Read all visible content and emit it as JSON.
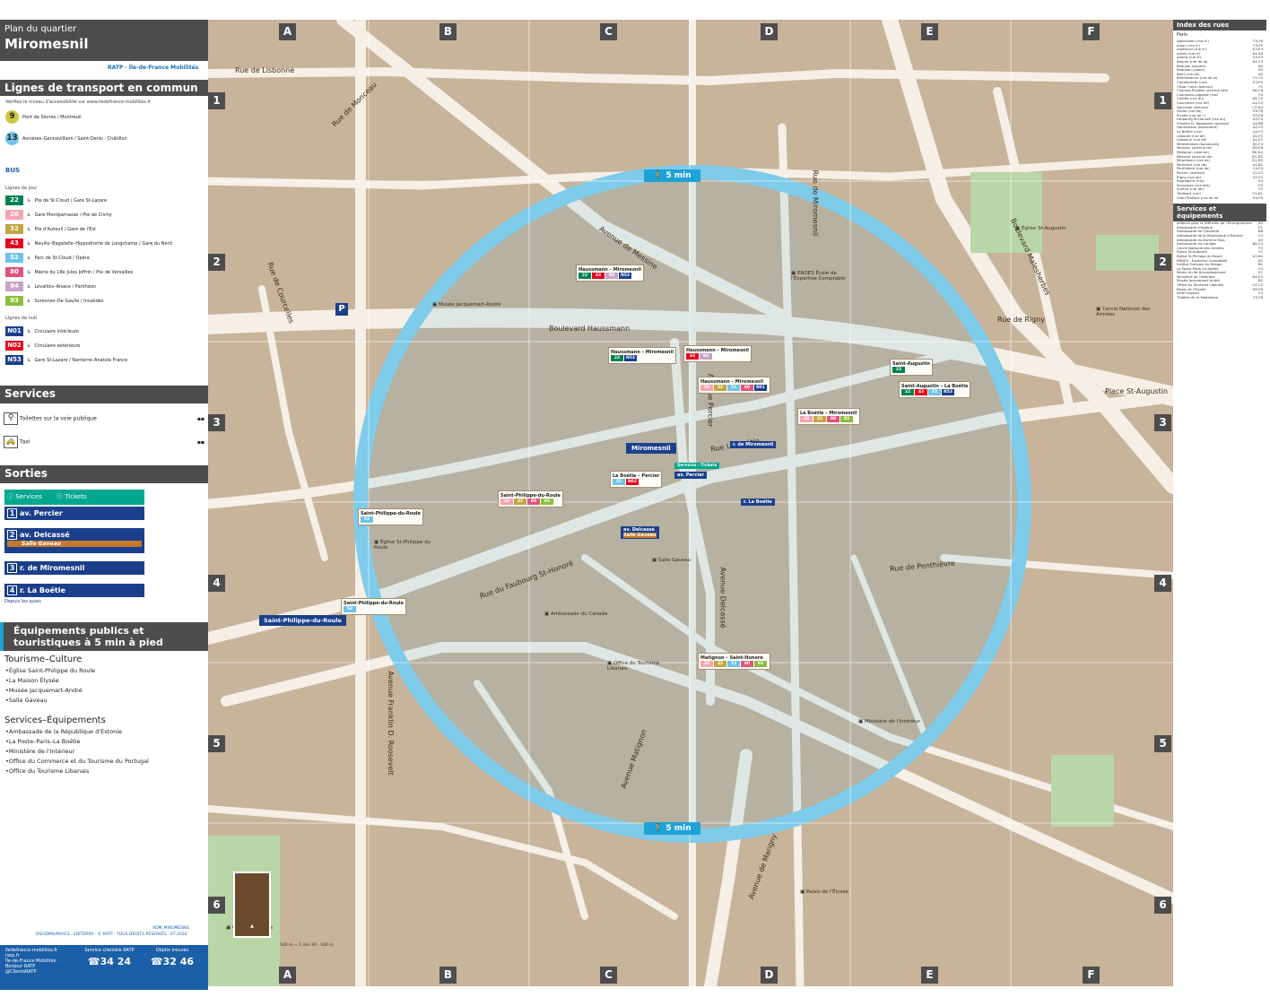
{
  "header": {
    "subtitle": "Plan du quartier",
    "title": "Miromesnil",
    "partners": "RATP · Île-de-France Mobilités"
  },
  "transport": {
    "heading": "Lignes de transport en commun",
    "note": "Vérifiez le niveau d'accessibilité sur www.iledefrance-mobilites.fr",
    "metro": [
      {
        "line": "9",
        "color": "#cdc83f",
        "dest": "Pont de Sèvres / Montreuil"
      },
      {
        "line": "13",
        "color": "#6ec4e8",
        "dest": "Asnières–Gennevilliers / Saint-Denis · Châtillon"
      }
    ],
    "bus_label": "BUS",
    "day_label": "Lignes de jour",
    "bus": [
      {
        "line": "22",
        "color": "#00814f",
        "dest": "Pte de St-Cloud / Gare St-Lazare"
      },
      {
        "line": "28",
        "color": "#f7a3b1",
        "dest": "Gare Montparnasse / Pte de Clichy"
      },
      {
        "line": "32",
        "color": "#c2a642",
        "dest": "Pte d'Auteuil / Gare de l'Est"
      },
      {
        "line": "43",
        "color": "#e3051b",
        "dest": "Neuilly–Bagatelle–Hippodrome de Longchamp / Gare du Nord"
      },
      {
        "line": "52",
        "color": "#6ec4e8",
        "dest": "Parc de St-Cloud / Opéra"
      },
      {
        "line": "80",
        "color": "#e0547a",
        "dest": "Mairie du 18e Jules Joffrin / Pte de Versailles"
      },
      {
        "line": "84",
        "color": "#c9a2c9",
        "dest": "Levallois–Alsace / Panthéon"
      },
      {
        "line": "93",
        "color": "#8cbe3f",
        "dest": "Suresnes–De Gaulle / Invalides"
      }
    ],
    "night_label": "Lignes de nuit",
    "night": [
      {
        "line": "N01",
        "color": "#1b3f8b",
        "dest": "Circulaire intérieure"
      },
      {
        "line": "N02",
        "color": "#e3051b",
        "dest": "Circulaire extérieure"
      },
      {
        "line": "N53",
        "color": "#1b3f8b",
        "dest": "Gare St-Lazare / Nanterre–Anatole France"
      }
    ]
  },
  "services": {
    "heading": "Services",
    "items": [
      "Toilettes sur la voie publique",
      "Taxi"
    ]
  },
  "sorties": {
    "heading": "Sorties",
    "services_label": "Services",
    "tickets_label": "Tickets",
    "exits": [
      {
        "n": "1",
        "name": "av. Percier"
      },
      {
        "n": "2",
        "name": "av. Delcassé",
        "sub": "Salle Gaveau"
      },
      {
        "n": "3",
        "name": "r. de Miromesnil"
      },
      {
        "n": "4",
        "name": "r. La Boétie",
        "sub": "Depuis les quais"
      }
    ]
  },
  "equipements": {
    "heading": "Équipements publics et touristiques à 5 min à pied",
    "tourism_h": "Tourisme–Culture",
    "tourism": [
      "•Église Saint-Philippe du Roule",
      "•La Maison Élysée",
      "•Musée Jacquemart-André",
      "•Salle Gaveau"
    ],
    "serv_h": "Services–Équipements",
    "serv": [
      "•Ambassade de la République d'Estonie",
      "•La Poste–Paris–La Boétie",
      "•Ministère de l'Intérieur",
      "•Office du Commerce et du Tourisme du Portugal",
      "•Office du Tourisme Libanais"
    ]
  },
  "footer": {
    "web": "iledefrance-mobilites.fr",
    "app": "ratp.fr",
    "bonjour": "Île-de-France Mobilités · Bonjour RATP",
    "twitter": "@ClientsRATP",
    "client_label": "Service clientèle RATP",
    "client_num": "34 24",
    "lost_label": "Objets trouvés",
    "lost_num": "32 46",
    "credit": "DSF/DMO/RIVICS · EDITERRA · © RATP · TOUS DROITS RÉSERVÉS · 07.2024",
    "ref": "ADM_MIROMESNIL",
    "scale_100": "100 m",
    "scale_time": "100 m = 1 min 30"
  },
  "map": {
    "walk_label": "5 min",
    "cols": [
      "A",
      "B",
      "C",
      "D",
      "E",
      "F"
    ],
    "rows": [
      "1",
      "2",
      "3",
      "4",
      "5",
      "6"
    ],
    "streets": [
      "Rue de Lisbonne",
      "Avenue de Messine",
      "Boulevard Haussmann",
      "Rue La Boétie",
      "Rue du Faubourg St-Honoré",
      "Avenue Percier",
      "Avenue Delcassé",
      "Rue de Miromesnil",
      "Boulevard Malesherbes",
      "Avenue Franklin D. Roosevelt",
      "Avenue de Marigny",
      "Place St-Augustin",
      "Rue de Penthièvre",
      "Rue de Courcelles",
      "Avenue Matignon",
      "Rue de Monceau",
      "Rue de Rigny"
    ],
    "places": [
      "Musée Jacquemart-André",
      "Église St-Augustin",
      "Ministère de l'Intérieur",
      "Église St-Philippe du Roule",
      "Salle Gaveau",
      "Cercle National des Armées",
      "Palais de l'Élysée",
      "Ambassade du Canada",
      "Office du Tourisme Libanais",
      "ENDES École de l'Expertise Comptable",
      "Champs-Élysées"
    ],
    "stops": [
      {
        "name": "Haussmann – Miromesnil",
        "lines": [
          "22",
          "43",
          "84",
          "N53"
        ]
      },
      {
        "name": "Haussmann – Miromesnil",
        "lines": [
          "22",
          "N53"
        ]
      },
      {
        "name": "Haussmann – Miromesnil",
        "lines": [
          "43",
          "84"
        ]
      },
      {
        "name": "Haussmann – Miromesnil",
        "lines": [
          "28",
          "32",
          "52",
          "80",
          "N01"
        ]
      },
      {
        "name": "La Boétie – Miromesnil",
        "lines": [
          "28",
          "32",
          "80",
          "93"
        ]
      },
      {
        "name": "Saint-Augustin",
        "lines": [
          "22"
        ]
      },
      {
        "name": "Saint-Augustin – La Boétie",
        "lines": [
          "22",
          "43",
          "52",
          "N53"
        ]
      },
      {
        "name": "La Boétie – Percier",
        "lines": [
          "52",
          "N02"
        ]
      },
      {
        "name": "Saint-Philippe-du-Roule",
        "lines": [
          "28",
          "32",
          "80",
          "93"
        ]
      },
      {
        "name": "Saint-Philippe-du-Roule",
        "lines": [
          "52"
        ]
      },
      {
        "name": "Saint-Philippe-du-Roule",
        "lines": [
          "52"
        ]
      },
      {
        "name": "Matignon – Saint-Honoré",
        "lines": [
          "28",
          "32",
          "52",
          "80",
          "93"
        ]
      }
    ],
    "metro_station": "Miromesnil",
    "metro_station2": "Saint-Philippe-du-Roule",
    "exit_labels": [
      "av. Percier",
      "r. de Miromesnil",
      "r. La Boétie",
      "av. Delcassé"
    ],
    "exit_sub": "Salle Gaveau",
    "services_tickets": "Services · Tickets"
  },
  "index": {
    "heading": "Index des rues",
    "city": "Paris",
    "streets": [
      [
        "Aguesseau (rue d')",
        "F5-F6"
      ],
      [
        "Anjou (rue d')",
        "F3-F5"
      ],
      [
        "Argenson (rue d')",
        "E3-E4"
      ],
      [
        "Artois (rue d')",
        "A4-A5"
      ],
      [
        "Astorg (rue d')",
        "E3-F3"
      ],
      [
        "Baume (rue de la)",
        "A3-C3"
      ],
      [
        "Beaujon (square)",
        "B2"
      ],
      [
        "Beauvau (place)",
        "E5"
      ],
      [
        "Berri (rue de)",
        "A3"
      ],
      [
        "Bienfaisance (rue de la)",
        "C1-F1"
      ],
      [
        "Cambacérès (rue)",
        "E3-E5"
      ],
      [
        "César Caire (avenue)",
        "F2"
      ],
      [
        "Champs-Élysées (avenue des)",
        "A6-C6"
      ],
      [
        "Chauveau-Lagarde (rue)",
        "F4"
      ],
      [
        "Colisée (rue du)",
        "A5-C5"
      ],
      [
        "Courcelles (rue de)",
        "A1-C3"
      ],
      [
        "Delcassé (avenue)",
        "C3-D4"
      ],
      [
        "Duras (rue de)",
        "E5-F6"
      ],
      [
        "Élysée (rue de l')",
        "E5-E6"
      ],
      [
        "Faubourg St-Honoré (rue du)",
        "A3-F5"
      ],
      [
        "Franklin D. Roosevelt (avenue)",
        "A4-B6"
      ],
      [
        "Haussmann (boulevard)",
        "A2-F3"
      ],
      [
        "La Boétie (rue)",
        "A4-F3"
      ],
      [
        "Laborde (rue de)",
        "D2-F2"
      ],
      [
        "Lisbonne (rue de)",
        "A1-E1"
      ],
      [
        "Malesherbes (boulevard)",
        "D1-F4"
      ],
      [
        "Marigny (avenue de)",
        "D5-E6"
      ],
      [
        "Matignon (avenue)",
        "B6-D4"
      ],
      [
        "Messine (avenue de)",
        "B1-D2"
      ],
      [
        "Miromesnil (rue de)",
        "D1-D5"
      ],
      [
        "Monceau (rue de)",
        "A1-B1"
      ],
      [
        "Penthièvre (rue de)",
        "C4-F4"
      ],
      [
        "Percier (avenue)",
        "C2-C3"
      ],
      [
        "Rigny (rue de)",
        "E2-F2"
      ],
      [
        "Roquépine (rue)",
        "E4"
      ],
      [
        "Saussaies (rue des)",
        "E5"
      ],
      [
        "Surène (rue de)",
        "F5"
      ],
      [
        "Treilhard (rue)",
        "C1-D1"
      ],
      [
        "Ville-l'Évêque (rue de la)",
        "E4-F5"
      ]
    ],
    "equip_heading": "Services et équipements",
    "equip": [
      [
        "Alliance pour la Diffusion de l'Enseignement",
        "A4"
      ],
      [
        "Ambassade d'Algérie",
        "E1"
      ],
      [
        "Ambassade de Colombie",
        "B6"
      ],
      [
        "Ambassade de la République d'Estonie",
        "C3"
      ],
      [
        "Ambassade du Burkina Faso",
        "A3"
      ],
      [
        "Ambassade du Canada",
        "B4-C4"
      ],
      [
        "Cercle National des Armées",
        "F2"
      ],
      [
        "Église St-Augustin",
        "F2"
      ],
      [
        "Église St-Philippe du Roule",
        "A3-B4"
      ],
      [
        "ENDES · Expertise Comptable",
        "D2"
      ],
      [
        "Institut Français du Design",
        "B1"
      ],
      [
        "La Poste–Paris–La Boétie",
        "C4"
      ],
      [
        "Mairie du 8e Arrondissement",
        "E1"
      ],
      [
        "Ministère de l'Intérieur",
        "D4-E5"
      ],
      [
        "Musée Jacquemart-André",
        "B2"
      ],
      [
        "Office du Tourisme Libanais",
        "C4-C5"
      ],
      [
        "Palais de l'Élysée",
        "D5-E6"
      ],
      [
        "Salle Gaveau",
        "C4"
      ],
      [
        "Théâtre de la Madeleine",
        "F5-F6"
      ]
    ]
  }
}
